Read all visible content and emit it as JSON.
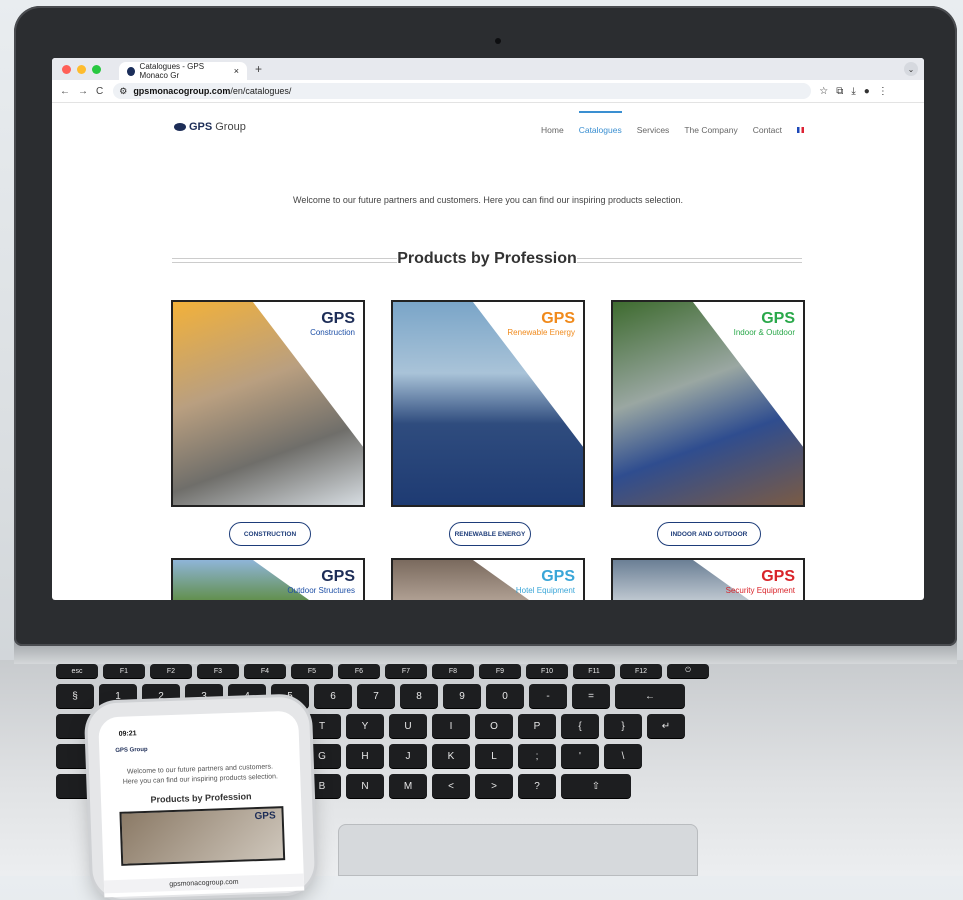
{
  "browser": {
    "tab_title": "Catalogues - GPS Monaco Gr",
    "tab_close": "×",
    "new_tab": "+",
    "back": "←",
    "forward": "→",
    "reload": "C",
    "url_host": "gpsmonacogroup.com",
    "url_path": "/en/catalogues/"
  },
  "site": {
    "logo_gps": "GPS",
    "logo_group": "Group",
    "menu": [
      "Home",
      "Catalogues",
      "Services",
      "The Company",
      "Contact"
    ],
    "welcome": "Welcome to our future partners and customers. Here you can find our inspiring products selection.",
    "section_title": "Products by Profession",
    "cards": [
      {
        "badge": "GPS",
        "subtitle": "Construction",
        "button": "CONSTRUCTION",
        "accent": "#1d4fa6"
      },
      {
        "badge": "GPS",
        "subtitle": "Renewable Energy",
        "button": "RENEWABLE ENERGY",
        "accent": "#f08a1c"
      },
      {
        "badge": "GPS",
        "subtitle": "Indoor & Outdoor",
        "button": "INDOOR AND OUTDOOR",
        "accent": "#2aa84a"
      },
      {
        "badge": "GPS",
        "subtitle": "Outdoor Structures",
        "accent": "#1d4fa6"
      },
      {
        "badge": "GPS",
        "subtitle": "Hotel Equipment",
        "accent": "#3aa6d8"
      },
      {
        "badge": "GPS",
        "subtitle": "Security Equipment",
        "accent": "#d9242a"
      }
    ]
  },
  "phone": {
    "time": "09:21",
    "logo": "GPS Group",
    "welcome": "Welcome to our future partners and customers. Here you can find our inspiring products selection.",
    "section_title": "Products by Profession",
    "card_badge": "GPS",
    "url": "gpsmonacogroup.com"
  }
}
